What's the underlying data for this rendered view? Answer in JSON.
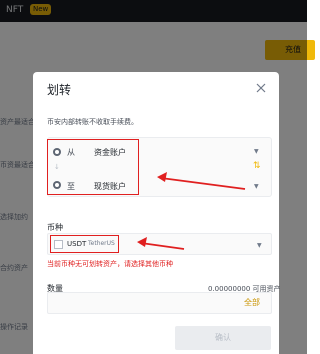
{
  "background": {
    "nft_label": "NFT",
    "new_badge": "New",
    "action_button_label": "充值",
    "side_texts": [
      "资产最适合您",
      "币资最适合您",
      "选择加约",
      "合约资产",
      "操作记录"
    ]
  },
  "modal": {
    "title": "划转",
    "subtitle": "币安内部转账不收取手续费。",
    "from": {
      "label": "从",
      "value": "资金账户"
    },
    "to": {
      "label": "至",
      "value": "现货账户"
    },
    "currency": {
      "label": "币种",
      "code": "USDT",
      "name": "TetherUS",
      "error": "当前币种无可划转资产，请选择其他币种"
    },
    "amount": {
      "label": "数量",
      "available_value": "0.00000000",
      "available_label": "可用资产",
      "all_label": "全部"
    },
    "confirm_label": "确认"
  },
  "colors": {
    "accent": "#f0b90b",
    "annotation_red": "#e02020"
  }
}
